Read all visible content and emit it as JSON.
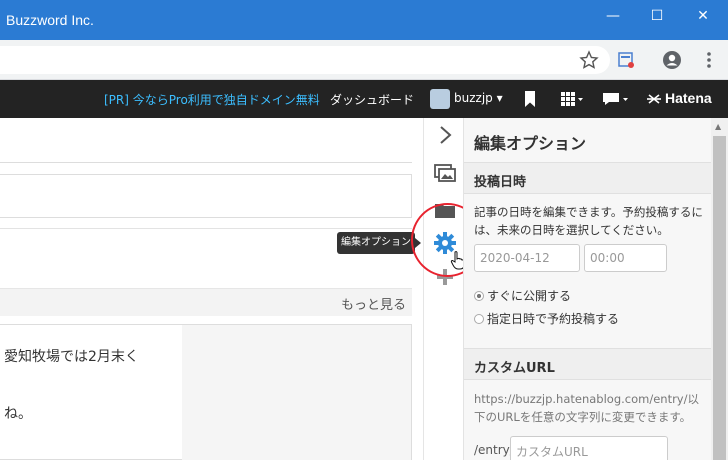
{
  "window": {
    "title": "Buzzword Inc.",
    "minimize_glyph": "—",
    "maximize_glyph": "☐",
    "close_glyph": "✕"
  },
  "hatena_bar": {
    "promo": "[PR] 今ならPro利用で独自ドメイン無料",
    "dashboard": "ダッシュボード",
    "username": "buzzjp",
    "logo": "Hatena"
  },
  "editor": {
    "more_link": "もっと見る",
    "body_lines": [
      "愛知牧場では2月末く",
      "ね。"
    ]
  },
  "tooltip": "編集オプション",
  "panel": {
    "title": "編集オプション",
    "post_date": {
      "heading": "投稿日時",
      "description": "記事の日時を編集できます。予約投稿するには、未来の日時を選択してください。",
      "date_placeholder": "2020-04-12",
      "time_placeholder": "00:00",
      "radio_now": "すぐに公開する",
      "radio_scheduled": "指定日時で予約投稿する",
      "selected": "now"
    },
    "custom_url": {
      "heading": "カスタムURL",
      "description": "https://buzzjp.hatenablog.com/entry/以下のURLを任意の文字列に変更できます。",
      "prefix": "/entry/",
      "placeholder": "カスタムURL"
    }
  },
  "colors": {
    "titlebar": "#2b7bd3",
    "hatena_bar": "#232323",
    "promo_link": "#3cbeff",
    "gear_active": "#2f8bd8",
    "highlight_circle": "#e8232f"
  }
}
